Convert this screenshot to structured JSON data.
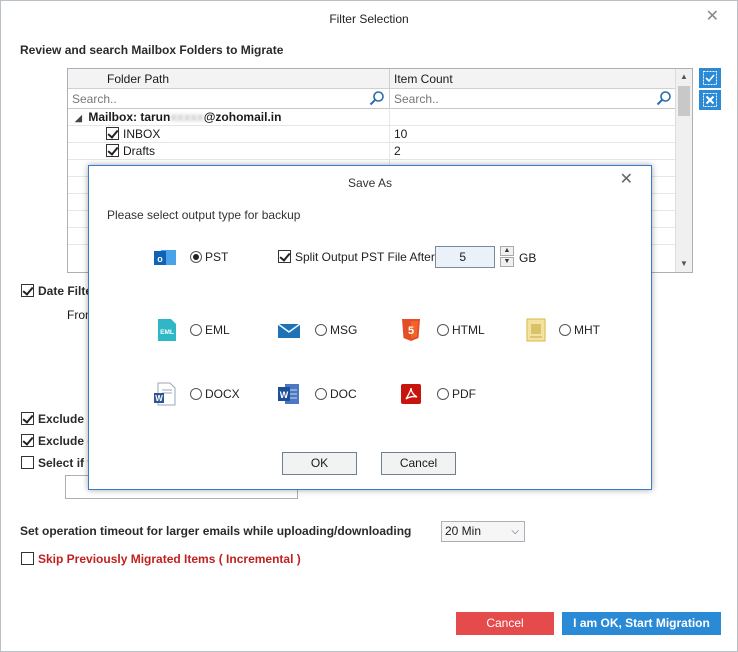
{
  "window": {
    "title": "Filter Selection",
    "close_glyph": "✕"
  },
  "section_title": "Review and search Mailbox Folders to Migrate",
  "grid": {
    "columns": [
      "Folder Path",
      "Item Count"
    ],
    "search_placeholder_1": "Search..",
    "search_placeholder_2": "Search..",
    "mailbox_label": "Mailbox: tarun",
    "mailbox_masked": "xxxxx",
    "mailbox_domain": "@zohomail.in",
    "rows": [
      {
        "name": "INBOX",
        "count": "10"
      },
      {
        "name": "Drafts",
        "count": "2"
      }
    ]
  },
  "options": {
    "date_filter": "Date Filter",
    "from": "From",
    "exclude_1": "Exclude De",
    "exclude_2": "Exclude em",
    "select_if": "Select if yo"
  },
  "timeout": {
    "label": "Set operation timeout for larger emails while uploading/downloading",
    "value": "20 Min"
  },
  "skip": "Skip Previously Migrated Items ( Incremental )",
  "buttons": {
    "cancel": "Cancel",
    "start": "I am OK, Start Migration"
  },
  "modal": {
    "title": "Save As",
    "close_glyph": "✕",
    "prompt": "Please select output type for backup",
    "split_label": "Split Output PST File After:",
    "split_value": "5",
    "split_unit": "GB",
    "types": {
      "pst": "PST",
      "eml": "EML",
      "msg": "MSG",
      "html": "HTML",
      "mht": "MHT",
      "docx": "DOCX",
      "doc": "DOC",
      "pdf": "PDF"
    },
    "selected": "PST",
    "ok": "OK",
    "cancel": "Cancel"
  },
  "colors": {
    "accent_blue": "#2b8ad6",
    "cancel_red": "#e64b4b",
    "skip_red": "#c21f1f"
  }
}
